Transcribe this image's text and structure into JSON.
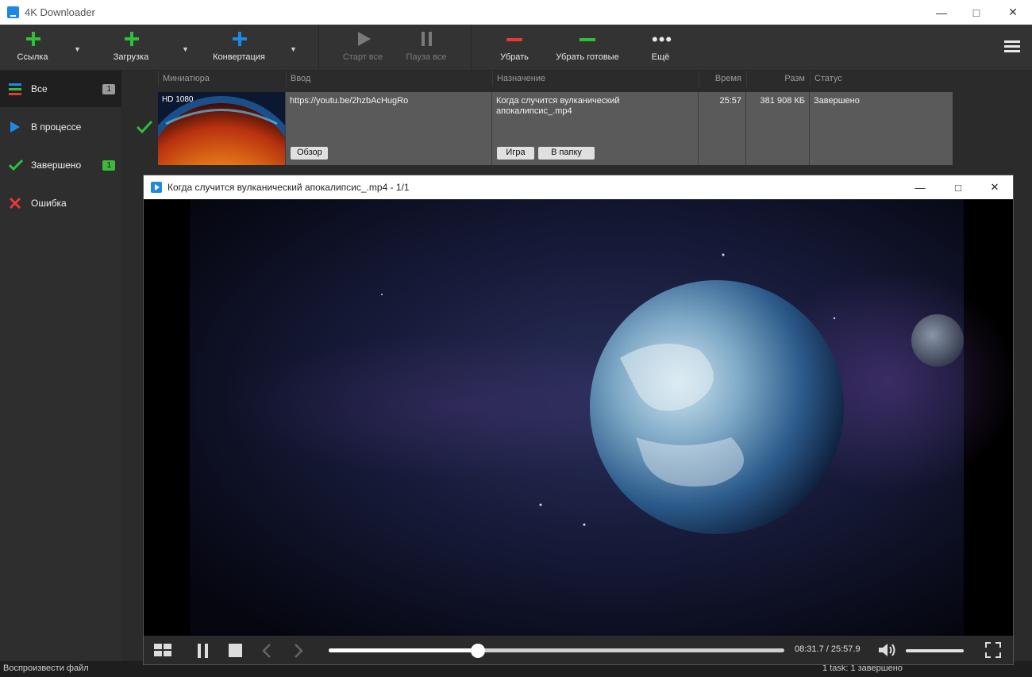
{
  "window": {
    "title": "4K Downloader"
  },
  "toolbar": {
    "link": "Ссылка",
    "download": "Загрузка",
    "convert": "Конвертация",
    "start_all": "Старт все",
    "pause_all": "Пауза все",
    "remove": "Убрать",
    "remove_done": "Убрать готовые",
    "more": "Ещё"
  },
  "colors": {
    "green": "#2fbf3a",
    "blue": "#1e88e5",
    "red": "#e53935"
  },
  "sidebar": {
    "items": [
      {
        "label": "Все",
        "count": "1"
      },
      {
        "label": "В процессе"
      },
      {
        "label": "Завершено",
        "count": "1"
      },
      {
        "label": "Ошибка"
      }
    ]
  },
  "table": {
    "headers": [
      "Миниатюра",
      "Ввод",
      "Назначение",
      "Время",
      "Разм",
      "Статус"
    ],
    "row": {
      "quality": "HD 1080",
      "input": "https://youtu.be/2hzbAcHugRo",
      "destination": "Когда случится вулканический апокалипсис_.mp4",
      "time": "25:57",
      "size": "381 908 КБ",
      "status": "Завершено",
      "browse_btn": "Обзор",
      "play_btn": "Игра",
      "folder_btn": "В папку"
    }
  },
  "player": {
    "title": "Когда случится вулканический апокалипсис_.mp4 - 1/1",
    "time": "08:31.7 / 25:57.9",
    "progress": 0.328,
    "volume": 1.0
  },
  "statusbar": {
    "left": "Воспроизвести файл",
    "right": "1 task: 1 завершено"
  }
}
